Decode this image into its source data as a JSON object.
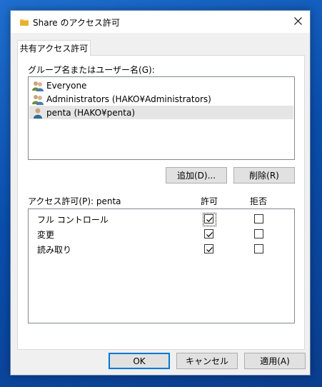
{
  "window": {
    "title": "Share のアクセス許可",
    "close_symbol": "✕"
  },
  "tab": {
    "label": "共有アクセス許可"
  },
  "users": {
    "label": "グループ名またはユーザー名(G):",
    "items": [
      {
        "name": "Everyone",
        "icon": "group-icon"
      },
      {
        "name": "Administrators (HAKO¥Administrators)",
        "icon": "group-icon"
      },
      {
        "name": "penta (HAKO¥penta)",
        "icon": "user-icon",
        "selected": true
      }
    ],
    "add_label": "追加(D)...",
    "remove_label": "削除(R)"
  },
  "permissions": {
    "label": "アクセス許可(P): penta",
    "allow_header": "許可",
    "deny_header": "拒否",
    "rows": [
      {
        "name": "フル コントロール",
        "allow": true,
        "deny": false
      },
      {
        "name": "変更",
        "allow": true,
        "deny": false
      },
      {
        "name": "読み取り",
        "allow": true,
        "deny": false
      }
    ]
  },
  "buttons": {
    "ok": "OK",
    "cancel": "キャンセル",
    "apply": "適用(A)"
  },
  "colors": {
    "accent": "#0078d7",
    "desktop": "#0a4fae"
  }
}
